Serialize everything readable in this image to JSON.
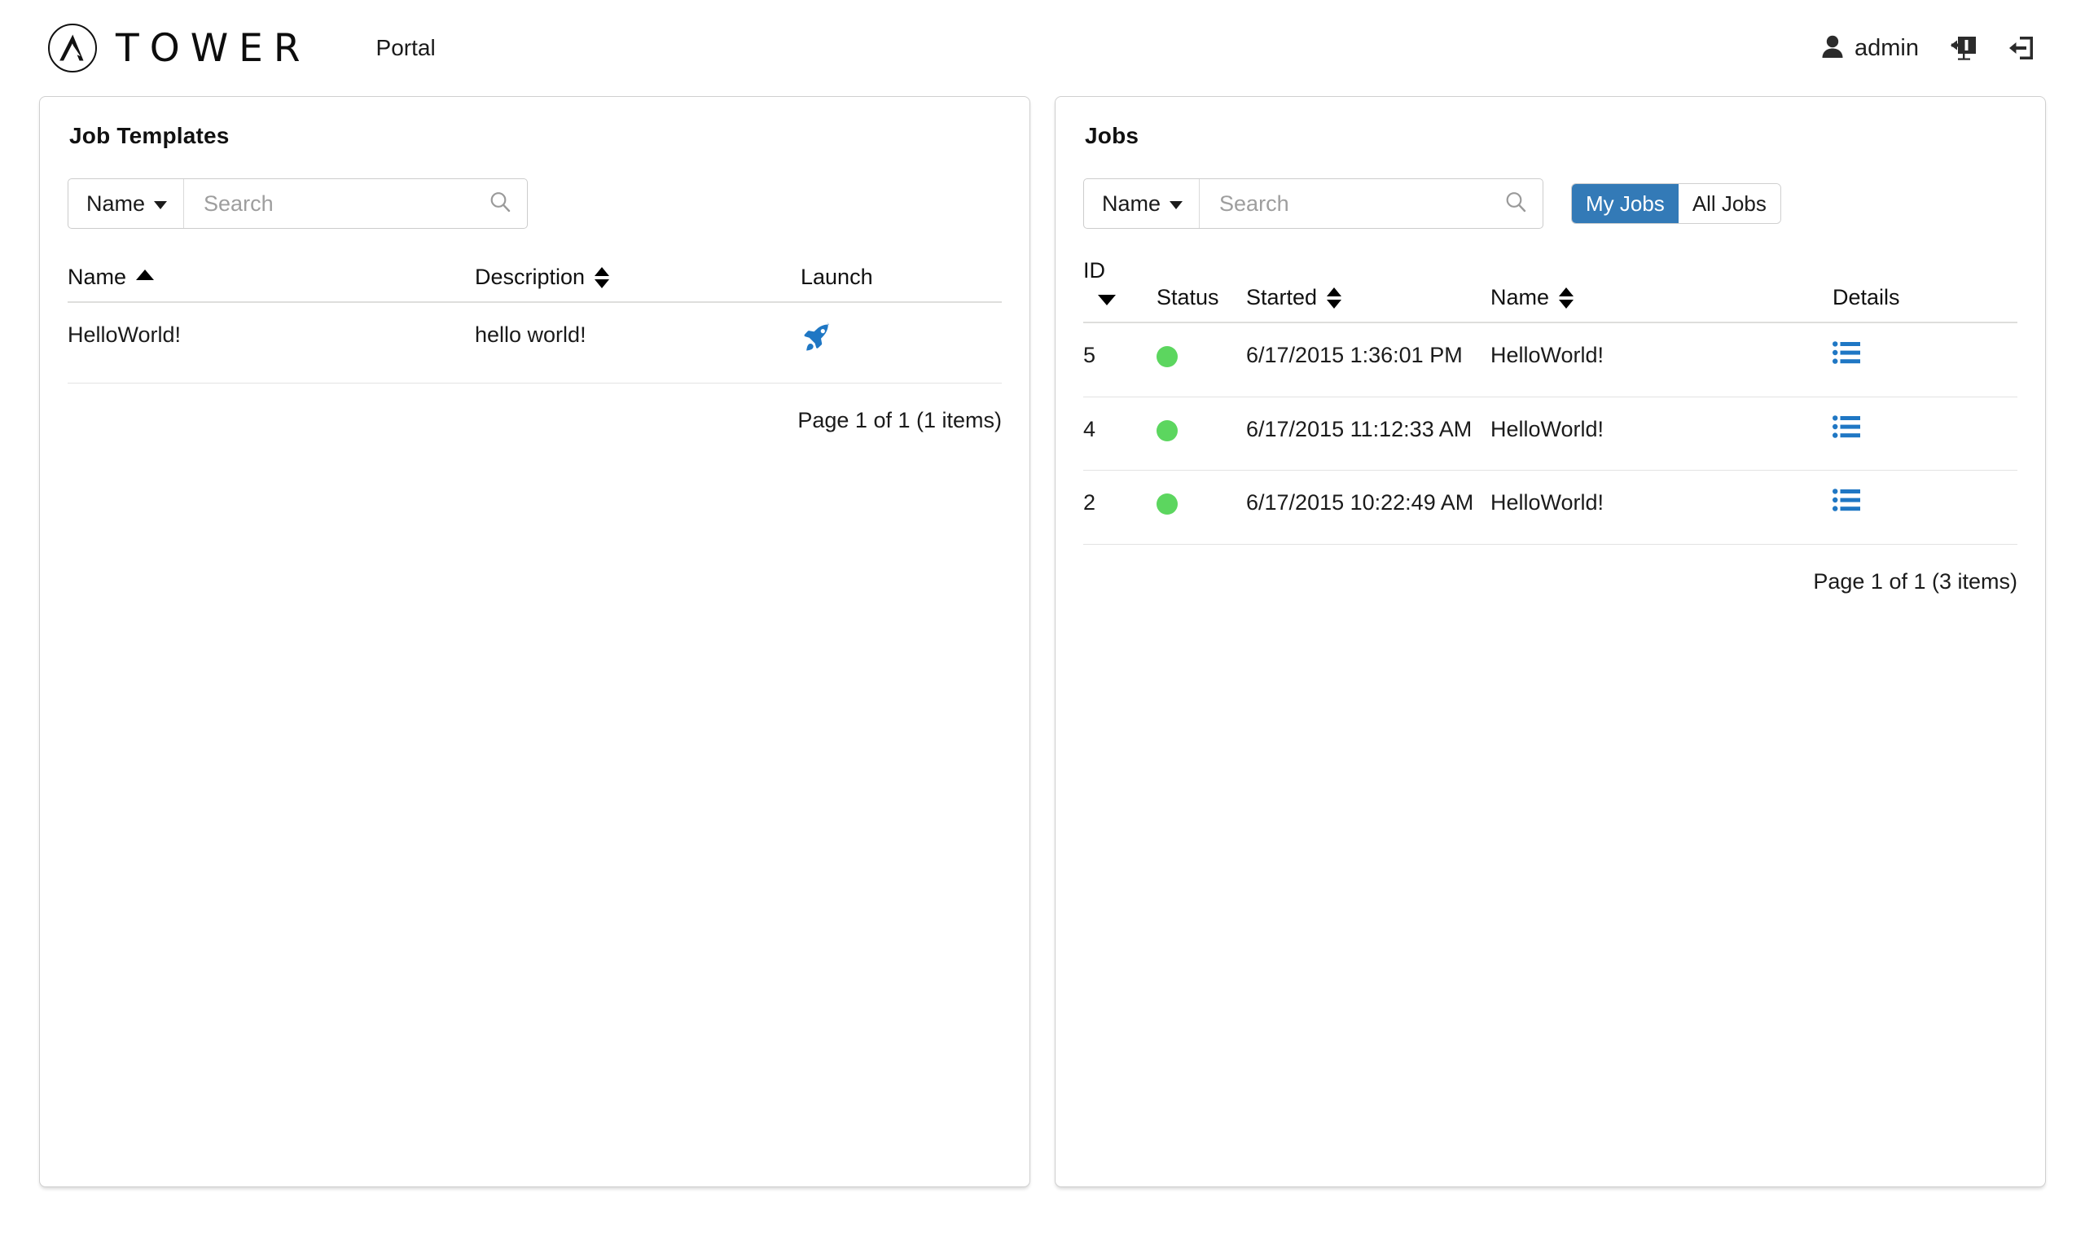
{
  "header": {
    "logo_icon": "ansible-logo-icon",
    "brand": "TOWER",
    "app_label": "Portal",
    "user_icon": "user-icon",
    "username": "admin",
    "screen_icon": "view-dashboard-icon",
    "logout_icon": "logout-icon"
  },
  "job_templates": {
    "title": "Job Templates",
    "search": {
      "filter_key": "Name",
      "placeholder": "Search",
      "value": "",
      "search_icon": "search-icon"
    },
    "columns": {
      "name": "Name",
      "description": "Description",
      "launch": "Launch"
    },
    "rows": [
      {
        "name": "HelloWorld!",
        "description": "hello world!",
        "launch_icon": "rocket-icon"
      }
    ],
    "pager": "Page 1 of 1 (1 items)"
  },
  "jobs": {
    "title": "Jobs",
    "search": {
      "filter_key": "Name",
      "placeholder": "Search",
      "value": "",
      "search_icon": "search-icon"
    },
    "toggle": {
      "my_jobs": "My Jobs",
      "all_jobs": "All Jobs",
      "active": "My Jobs"
    },
    "columns": {
      "id": "ID",
      "status": "Status",
      "started": "Started",
      "name": "Name",
      "details": "Details"
    },
    "rows": [
      {
        "id": "5",
        "status": "successful",
        "started": "6/17/2015 1:36:01 PM",
        "name": "HelloWorld!",
        "details_icon": "list-icon"
      },
      {
        "id": "4",
        "status": "successful",
        "started": "6/17/2015 11:12:33 AM",
        "name": "HelloWorld!",
        "details_icon": "list-icon"
      },
      {
        "id": "2",
        "status": "successful",
        "started": "6/17/2015 10:22:49 AM",
        "name": "HelloWorld!",
        "details_icon": "list-icon"
      }
    ],
    "pager": "Page 1 of 1 (3 items)"
  },
  "colors": {
    "accent_blue": "#337ab7",
    "status_green": "#5cd65f",
    "icon_blue": "#1f77c4",
    "text": "#1b1b1b",
    "border": "#cfcfcf"
  }
}
